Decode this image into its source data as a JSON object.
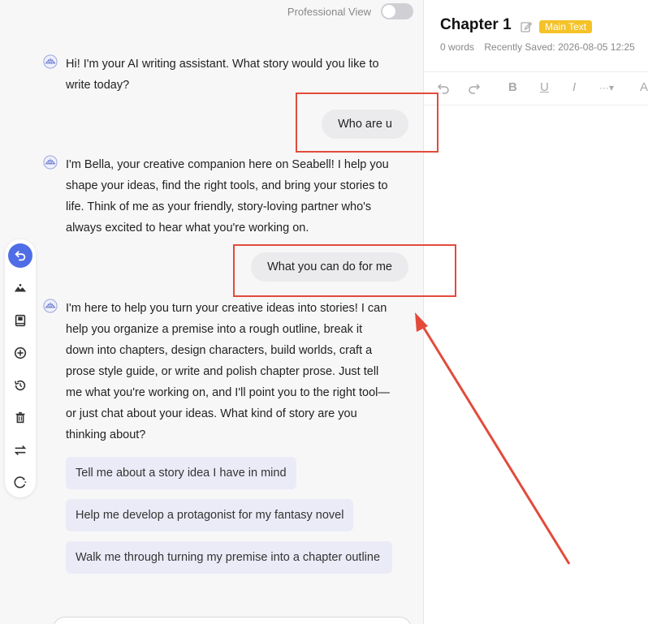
{
  "chat": {
    "professional_view_label": "Professional View",
    "messages": [
      {
        "role": "ai",
        "text": "Hi! I'm your AI writing assistant. What story would you like to write today?"
      },
      {
        "role": "user",
        "text": "Who are u"
      },
      {
        "role": "ai",
        "text": "I'm Bella, your creative companion here on Seabell! I help you shape your ideas, find the right tools, and bring your stories to life. Think of me as your friendly, story-loving partner who's always excited to hear what you're working on."
      },
      {
        "role": "user",
        "text": "What you can do for me"
      },
      {
        "role": "ai",
        "text": "I'm here to help you turn your creative ideas into stories! I can help you organize a premise into a rough outline, break it down into chapters, design characters, build worlds, craft a prose style guide, or write and polish chapter prose. Just tell me what you're working on, and I'll point you to the right tool—or just chat about your ideas. What kind of story are you thinking about?"
      }
    ],
    "suggestions": [
      "Tell me about a story idea I have in mind",
      "Help me develop a protagonist for my fantasy novel",
      "Walk me through turning my premise into a chapter outline"
    ]
  },
  "toolrail": {
    "icons": [
      "undo-arrow-icon",
      "landscape-icon",
      "book-icon",
      "add-circle-icon",
      "history-icon",
      "trash-icon",
      "swap-icon",
      "theme-icon"
    ]
  },
  "editor": {
    "chapter_title": "Chapter 1",
    "badge": "Main Text",
    "word_count": "0 words",
    "saved_status": "Recently Saved: 2026-08-05 12:25",
    "toolbar": {
      "bold": "B",
      "underline": "U",
      "italic": "I",
      "more": "···▾",
      "text": "A"
    }
  },
  "colors": {
    "accent": "#4f6de6",
    "badge": "#f5c227",
    "annotation": "#e24b3b",
    "suggestion_bg": "#ebebf8"
  }
}
